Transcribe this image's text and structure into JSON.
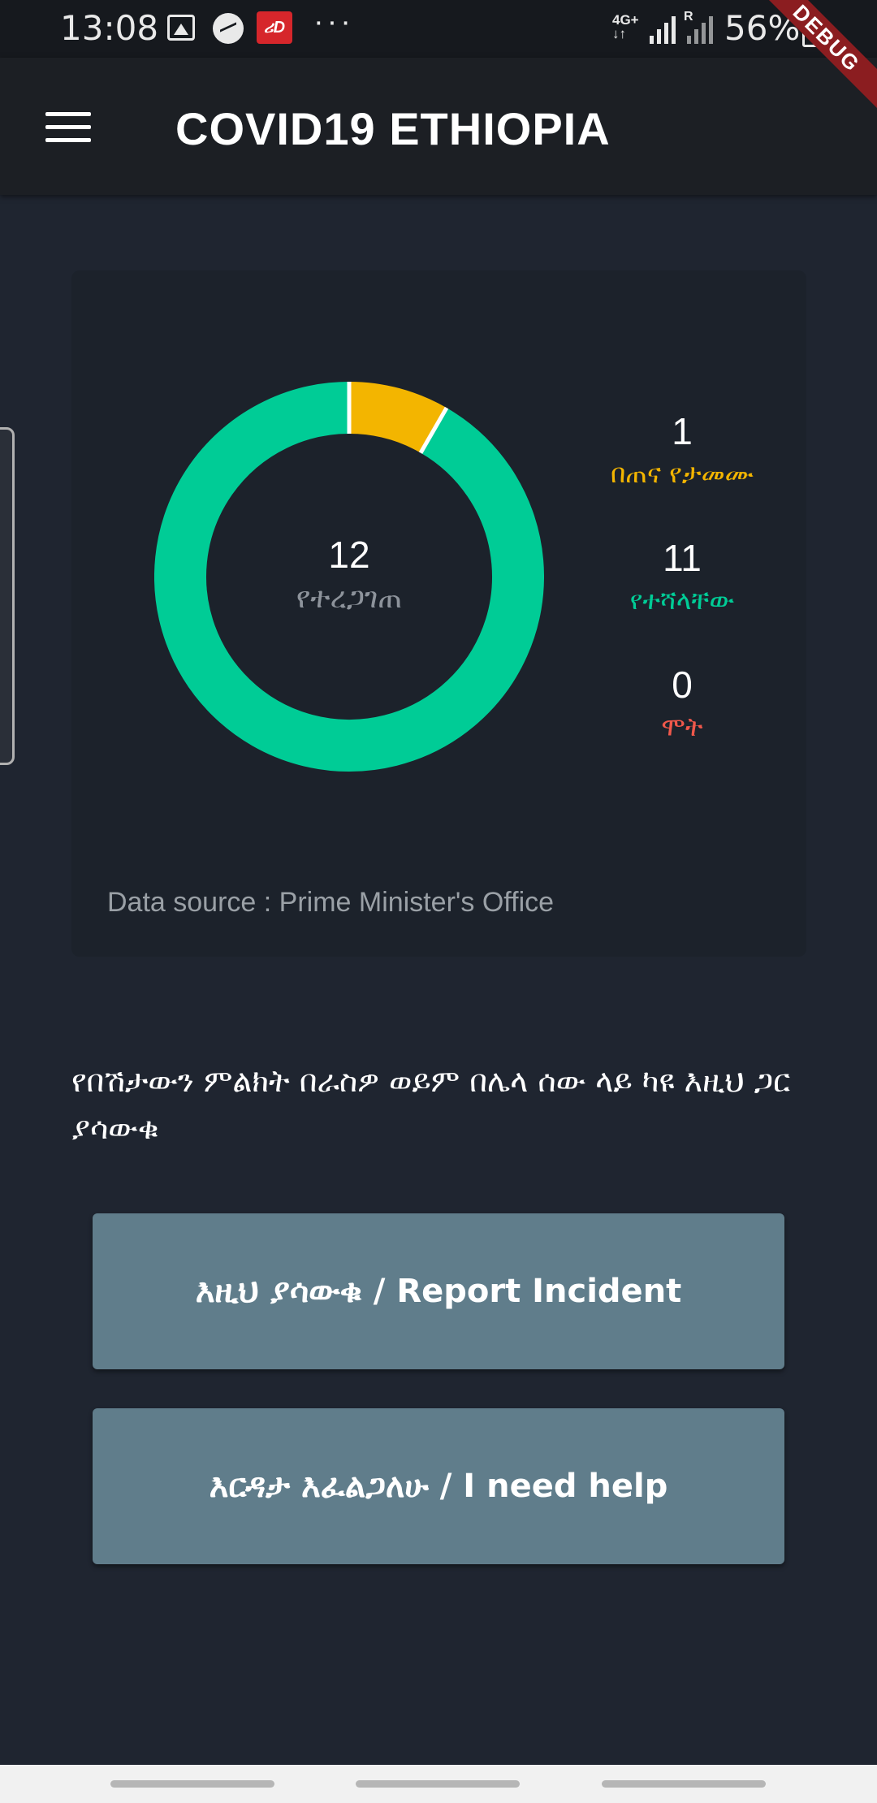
{
  "status_bar": {
    "time": "13:08",
    "brand_icon_text": "ሪD",
    "more": "···",
    "network_top": "4G+",
    "network_bottom": "↓↑",
    "roaming": "R",
    "battery": "56%"
  },
  "debug_banner": "DEBUG",
  "app_bar": {
    "title": "COVID19 ETHIOPIA",
    "menu_icon": "hamburger-menu-icon"
  },
  "summary": {
    "total_value": "12",
    "total_label": "የተረጋገጠ",
    "stats": [
      {
        "value": "1",
        "label": "በጠና የታመሙ",
        "color": "#f3b500"
      },
      {
        "value": "11",
        "label": "የተሻላቸው",
        "color": "#00cc96"
      },
      {
        "value": "0",
        "label": "ሞት",
        "color": "#f0584b"
      }
    ],
    "data_source": "Data source : Prime Minister's Office"
  },
  "chart_data": {
    "type": "pie",
    "categories": [
      "በጠና የታመሙ",
      "የተሻላቸው",
      "ሞት"
    ],
    "values": [
      1,
      11,
      0
    ],
    "colors": [
      "#f3b500",
      "#00cc96",
      "#f0584b"
    ]
  },
  "instruction": "የበሽታውን ምልክት በራስዎ ወይም በሌላ ሰው ላይ ካዩ እዚህ ጋር ያሳውቁ",
  "buttons": {
    "report": "እዚህ ያሳውቁ / Report Incident",
    "help": "እርዳታ እፈልጋለሁ / I need help"
  },
  "colors": {
    "background": "#1f2530",
    "card": "#1c222b",
    "button": "#607d8b"
  }
}
